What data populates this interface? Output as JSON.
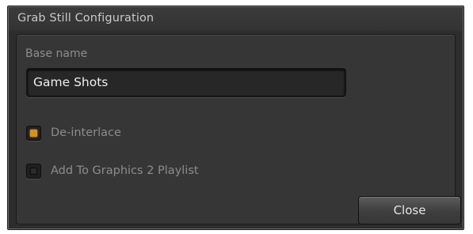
{
  "dialog": {
    "title": "Grab Still Configuration"
  },
  "base_name": {
    "label": "Base name",
    "value": "Game Shots"
  },
  "options": [
    {
      "label": "De-interlace",
      "checked": true
    },
    {
      "label": "Add To Graphics 2 Playlist",
      "checked": false
    }
  ],
  "buttons": {
    "close_label": "Close"
  },
  "colors": {
    "accent_check": "#d9901c",
    "window_bg": "#2d2d2d",
    "panel_bg": "#363636"
  }
}
